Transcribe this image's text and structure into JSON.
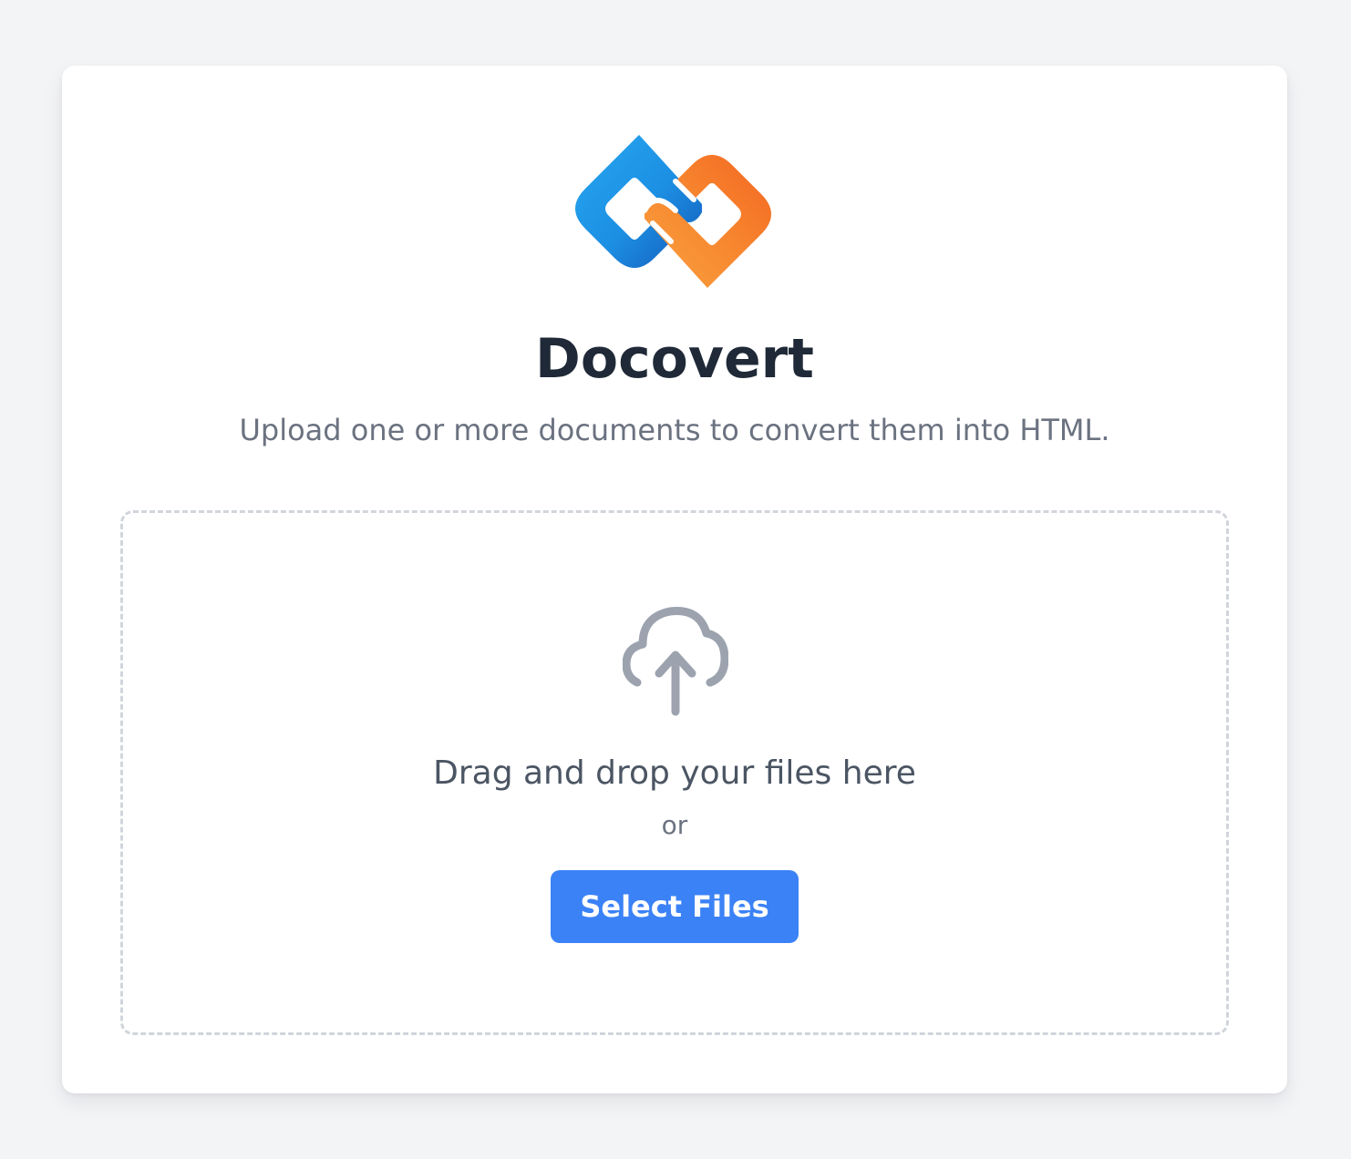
{
  "app": {
    "name": "Docovert",
    "subtitle": "Upload one or more documents to convert them into HTML."
  },
  "upload": {
    "drop_label": "Drag and drop your files here",
    "or_label": "or",
    "button_label": "Select Files",
    "icon": "cloud-upload-icon"
  },
  "colors": {
    "page_background": "#f3f4f6",
    "card_background": "#ffffff",
    "title": "#1f2937",
    "subtitle": "#6b7280",
    "dropzone_border": "#d1d5db",
    "upload_icon": "#9ca3af",
    "button": "#3b82f6",
    "button_text": "#ffffff",
    "logo_blue": "#1e9be8",
    "logo_orange": "#f7802b"
  }
}
